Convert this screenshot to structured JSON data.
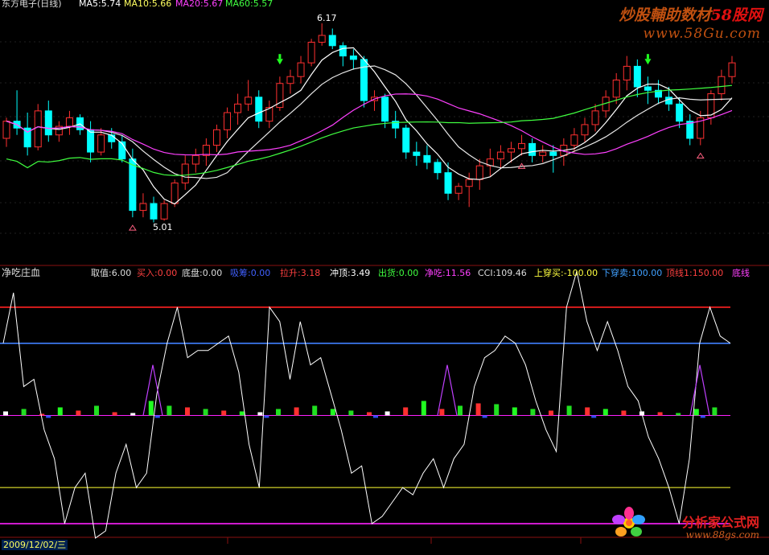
{
  "header": {
    "title": "东方电子(日线)",
    "ma5": "MA5:5.74",
    "ma10": "MA10:5.66",
    "ma20": "MA20:5.67",
    "ma60": "MA60:5.57"
  },
  "indicator_header": {
    "name": "净吃庄血",
    "items": [
      {
        "label": "取值:6.00",
        "color": "#dddddd"
      },
      {
        "label": "买入:0.00",
        "color": "#ff4040"
      },
      {
        "label": "底盘:0.00",
        "color": "#dddddd"
      },
      {
        "label": "吸筹:0.00",
        "color": "#4060ff"
      },
      {
        "label": "拉升:3.18",
        "color": "#ff4040"
      },
      {
        "label": "冲顶:3.49",
        "color": "#ffffff"
      },
      {
        "label": "出货:0.00",
        "color": "#40ff40"
      },
      {
        "label": "净吃:11.56",
        "color": "#ff40ff"
      },
      {
        "label": "CCI:109.46",
        "color": "#dddddd"
      },
      {
        "label": "上穿买:-100.00",
        "color": "#ffff40"
      },
      {
        "label": "下穿卖:100.00",
        "color": "#40a0ff"
      },
      {
        "label": "顶线1:150.00",
        "color": "#ff4040"
      },
      {
        "label": "底线",
        "color": "#ff40ff"
      }
    ]
  },
  "price_labels": {
    "high": "6.17",
    "low": "5.01"
  },
  "date_label": "2009/12/02/三",
  "watermarks": {
    "top_brand_a": "炒股輔助数材",
    "top_brand_b": "58股网",
    "top_url": "www.58Gu.com",
    "bottom_brand": "分析家公式网",
    "bottom_url": "www.88gs.com"
  },
  "colors": {
    "up": "#ff3030",
    "down": "#00ffff",
    "ma5": "#ffffff",
    "ma10": "#ffffff",
    "ma20": "#ff40ff",
    "ma60": "#40ff40",
    "top_line": "#ff2020",
    "upper_line": "#4080ff",
    "lower_line": "#a0a020",
    "bottom_line": "#ff20ff",
    "cci": "#ffffff"
  },
  "chart_data": [
    {
      "type": "candlestick",
      "title": "东方电子(日线)",
      "ylim": [
        4.9,
        6.25
      ],
      "candles": [
        [
          5.5,
          5.62,
          5.45,
          5.6
        ],
        [
          5.6,
          5.78,
          5.52,
          5.56
        ],
        [
          5.56,
          5.65,
          5.4,
          5.45
        ],
        [
          5.45,
          5.7,
          5.43,
          5.66
        ],
        [
          5.66,
          5.72,
          5.48,
          5.52
        ],
        [
          5.52,
          5.6,
          5.48,
          5.57
        ],
        [
          5.57,
          5.66,
          5.52,
          5.62
        ],
        [
          5.62,
          5.64,
          5.52,
          5.55
        ],
        [
          5.55,
          5.6,
          5.36,
          5.42
        ],
        [
          5.42,
          5.56,
          5.4,
          5.52
        ],
        [
          5.52,
          5.56,
          5.44,
          5.48
        ],
        [
          5.48,
          5.52,
          5.36,
          5.38
        ],
        [
          5.38,
          5.44,
          5.04,
          5.08
        ],
        [
          5.08,
          5.18,
          5.04,
          5.12
        ],
        [
          5.12,
          5.16,
          5.01,
          5.03
        ],
        [
          5.03,
          5.14,
          5.02,
          5.12
        ],
        [
          5.12,
          5.26,
          5.1,
          5.24
        ],
        [
          5.24,
          5.4,
          5.2,
          5.35
        ],
        [
          5.35,
          5.44,
          5.3,
          5.4
        ],
        [
          5.4,
          5.5,
          5.34,
          5.46
        ],
        [
          5.46,
          5.58,
          5.42,
          5.55
        ],
        [
          5.55,
          5.68,
          5.5,
          5.65
        ],
        [
          5.65,
          5.76,
          5.58,
          5.7
        ],
        [
          5.7,
          5.84,
          5.66,
          5.74
        ],
        [
          5.74,
          5.78,
          5.56,
          5.6
        ],
        [
          5.6,
          5.72,
          5.56,
          5.68
        ],
        [
          5.68,
          5.86,
          5.66,
          5.82
        ],
        [
          5.82,
          5.9,
          5.76,
          5.86
        ],
        [
          5.86,
          5.98,
          5.82,
          5.94
        ],
        [
          5.94,
          6.08,
          5.92,
          6.06
        ],
        [
          6.06,
          6.17,
          6.04,
          6.1
        ],
        [
          6.1,
          6.14,
          6.02,
          6.04
        ],
        [
          6.04,
          6.06,
          5.92,
          5.98
        ],
        [
          5.98,
          6.02,
          5.9,
          5.96
        ],
        [
          5.96,
          5.98,
          5.68,
          5.72
        ],
        [
          5.72,
          5.78,
          5.66,
          5.74
        ],
        [
          5.74,
          5.76,
          5.56,
          5.6
        ],
        [
          5.6,
          5.66,
          5.5,
          5.56
        ],
        [
          5.56,
          5.58,
          5.38,
          5.42
        ],
        [
          5.42,
          5.48,
          5.34,
          5.4
        ],
        [
          5.4,
          5.46,
          5.32,
          5.36
        ],
        [
          5.36,
          5.38,
          5.26,
          5.3
        ],
        [
          5.3,
          5.36,
          5.14,
          5.18
        ],
        [
          5.18,
          5.24,
          5.14,
          5.22
        ],
        [
          5.22,
          5.3,
          5.1,
          5.26
        ],
        [
          5.26,
          5.38,
          5.2,
          5.34
        ],
        [
          5.34,
          5.44,
          5.28,
          5.38
        ],
        [
          5.38,
          5.46,
          5.32,
          5.42
        ],
        [
          5.42,
          5.48,
          5.36,
          5.44
        ],
        [
          5.44,
          5.52,
          5.4,
          5.47
        ],
        [
          5.47,
          5.5,
          5.36,
          5.4
        ],
        [
          5.4,
          5.46,
          5.36,
          5.42
        ],
        [
          5.42,
          5.46,
          5.3,
          5.4
        ],
        [
          5.4,
          5.5,
          5.34,
          5.46
        ],
        [
          5.46,
          5.56,
          5.42,
          5.52
        ],
        [
          5.52,
          5.62,
          5.48,
          5.58
        ],
        [
          5.58,
          5.7,
          5.54,
          5.66
        ],
        [
          5.66,
          5.78,
          5.62,
          5.74
        ],
        [
          5.74,
          5.88,
          5.7,
          5.84
        ],
        [
          5.84,
          5.98,
          5.78,
          5.92
        ],
        [
          5.92,
          5.96,
          5.74,
          5.8
        ],
        [
          5.8,
          5.86,
          5.7,
          5.78
        ],
        [
          5.78,
          5.84,
          5.7,
          5.74
        ],
        [
          5.74,
          5.8,
          5.66,
          5.7
        ],
        [
          5.7,
          5.74,
          5.56,
          5.6
        ],
        [
          5.6,
          5.64,
          5.46,
          5.5
        ],
        [
          5.5,
          5.66,
          5.46,
          5.62
        ],
        [
          5.62,
          5.78,
          5.58,
          5.76
        ],
        [
          5.76,
          5.9,
          5.72,
          5.86
        ],
        [
          5.86,
          5.98,
          5.82,
          5.94
        ]
      ]
    },
    {
      "type": "line",
      "title": "净吃庄血",
      "ylim": [
        -160,
        180
      ],
      "reference_lines": [
        150,
        100,
        0,
        -100,
        -150
      ],
      "cci": [
        100,
        170,
        40,
        50,
        -20,
        -60,
        -150,
        -100,
        -80,
        -170,
        -160,
        -80,
        -40,
        -100,
        -80,
        30,
        100,
        150,
        80,
        90,
        90,
        100,
        110,
        60,
        -40,
        -100,
        150,
        130,
        50,
        130,
        70,
        80,
        30,
        -20,
        -80,
        -70,
        -150,
        -140,
        -120,
        -100,
        -110,
        -80,
        -60,
        -100,
        -60,
        -40,
        40,
        80,
        90,
        110,
        100,
        70,
        20,
        -20,
        -50,
        150,
        200,
        130,
        90,
        130,
        90,
        40,
        20,
        -30,
        -60,
        -100,
        -150,
        -60,
        100,
        150,
        110,
        100
      ],
      "columns": [
        5,
        8,
        2,
        10,
        6,
        12,
        4,
        3,
        18,
        12,
        10,
        8,
        6,
        5,
        4,
        8,
        10,
        12,
        8,
        6,
        4,
        5,
        10,
        18,
        8,
        12,
        15,
        14,
        10,
        8,
        6,
        12,
        10,
        8,
        6,
        5,
        4,
        3,
        8,
        10
      ]
    }
  ]
}
